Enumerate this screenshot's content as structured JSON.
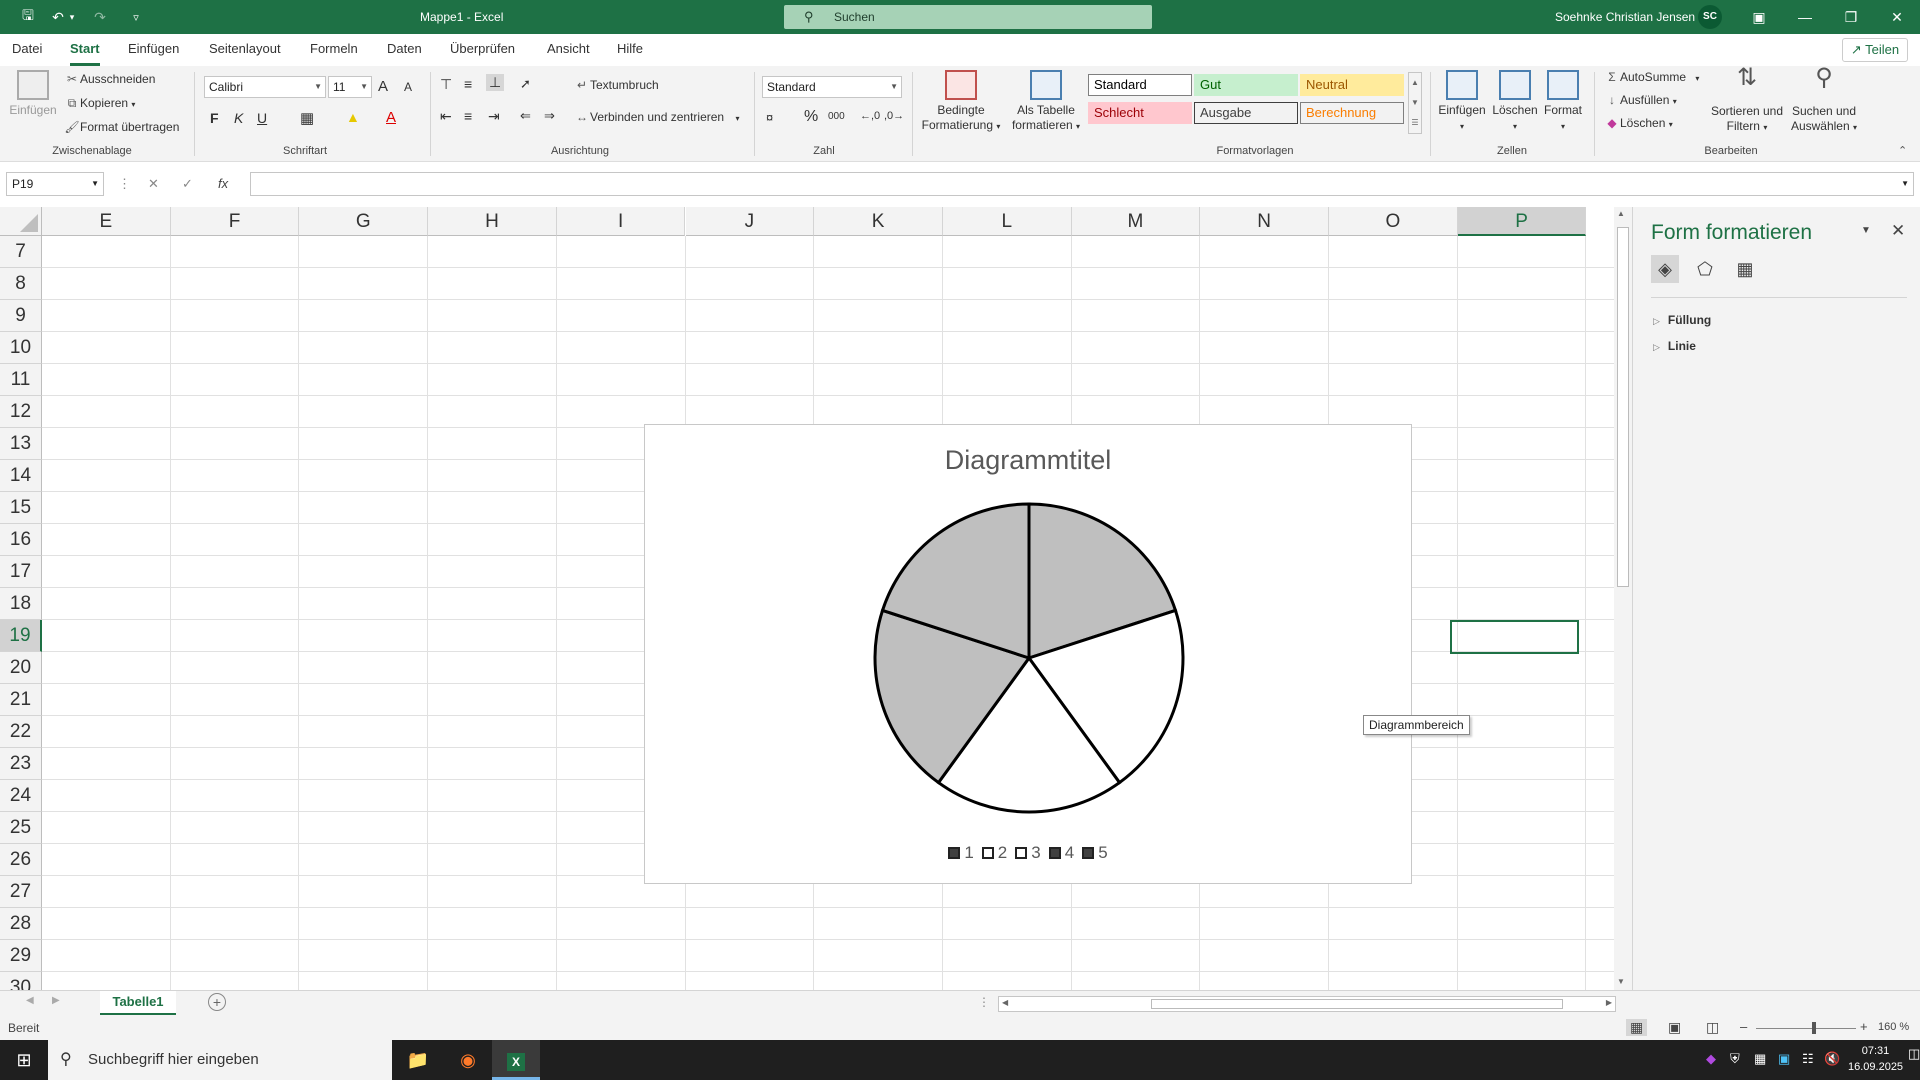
{
  "titlebar": {
    "doc_title": "Mappe1  -  Excel",
    "search_label": "Suchen",
    "user_name": "Soehnke Christian Jensen",
    "user_initials": "SC"
  },
  "tabs": [
    "Datei",
    "Start",
    "Einfügen",
    "Seitenlayout",
    "Formeln",
    "Daten",
    "Überprüfen",
    "Ansicht",
    "Hilfe"
  ],
  "active_tab": "Start",
  "share_label": "Teilen",
  "ribbon": {
    "clipboard": {
      "paste": "Einfügen",
      "cut": "Ausschneiden",
      "copy": "Kopieren",
      "format_painter": "Format übertragen",
      "group": "Zwischenablage"
    },
    "font": {
      "name": "Calibri",
      "size": "11",
      "bold": "F",
      "italic": "K",
      "underline": "U",
      "grow": "A",
      "shrink": "A",
      "group": "Schriftart"
    },
    "alignment": {
      "wrap": "Textumbruch",
      "merge": "Verbinden und zentrieren",
      "group": "Ausrichtung"
    },
    "number": {
      "format": "Standard",
      "percent": "%",
      "thousands": "000",
      "group": "Zahl"
    },
    "styles": {
      "conditional": [
        "Bedingte",
        "Formatierung"
      ],
      "as_table": [
        "Als Tabelle",
        "formatieren"
      ],
      "cells": [
        {
          "label": "Standard",
          "bg": "#ffffff",
          "fg": "#000000",
          "border": "#7f7f7f"
        },
        {
          "label": "Gut",
          "bg": "#c6efce",
          "fg": "#006100",
          "border": "#c6efce"
        },
        {
          "label": "Neutral",
          "bg": "#ffeb9c",
          "fg": "#9c5700",
          "border": "#ffeb9c"
        },
        {
          "label": "Schlecht",
          "bg": "#ffc7ce",
          "fg": "#9c0006",
          "border": "#ffc7ce"
        },
        {
          "label": "Ausgabe",
          "bg": "#f2f2f2",
          "fg": "#3f3f3f",
          "border": "#3f3f3f"
        },
        {
          "label": "Berechnung",
          "bg": "#f2f2f2",
          "fg": "#fa7d00",
          "border": "#7f7f7f"
        }
      ],
      "group": "Formatvorlagen"
    },
    "cells": {
      "insert": "Einfügen",
      "delete": "Löschen",
      "format": "Format",
      "group": "Zellen"
    },
    "editing": {
      "autosum": "AutoSumme",
      "fill": "Ausfüllen",
      "clear": "Löschen",
      "sort": [
        "Sortieren und",
        "Filtern"
      ],
      "find": [
        "Suchen und",
        "Auswählen"
      ],
      "group": "Bearbeiten"
    }
  },
  "formula_bar": {
    "name_box": "P19",
    "fx": "fx",
    "value": ""
  },
  "grid": {
    "columns": [
      "E",
      "F",
      "G",
      "H",
      "I",
      "J",
      "K",
      "L",
      "M",
      "N",
      "O",
      "P"
    ],
    "rows": [
      "7",
      "8",
      "9",
      "10",
      "11",
      "12",
      "13",
      "14",
      "15",
      "16",
      "17",
      "18",
      "19",
      "20",
      "21",
      "22",
      "23",
      "24",
      "25",
      "26",
      "27",
      "28",
      "29",
      "30"
    ],
    "selected_column": "P",
    "selected_row": "19"
  },
  "chart_data": {
    "type": "pie",
    "title": "Diagrammtitel",
    "categories": [
      "1",
      "2",
      "3",
      "4",
      "5"
    ],
    "values": [
      1,
      1,
      1,
      1,
      1
    ],
    "slice_colors": [
      "#bfbfbf",
      "#ffffff",
      "#ffffff",
      "#bfbfbf",
      "#bfbfbf"
    ],
    "legend": "bottom"
  },
  "tooltip": "Diagrammbereich",
  "pane": {
    "title": "Form formatieren",
    "sections": [
      "Füllung",
      "Linie"
    ]
  },
  "sheet_tab": "Tabelle1",
  "status": {
    "ready": "Bereit",
    "zoom": "160 %"
  },
  "taskbar": {
    "search_placeholder": "Suchbegriff hier eingeben",
    "time": "07:31",
    "date": "16.09.2025"
  }
}
